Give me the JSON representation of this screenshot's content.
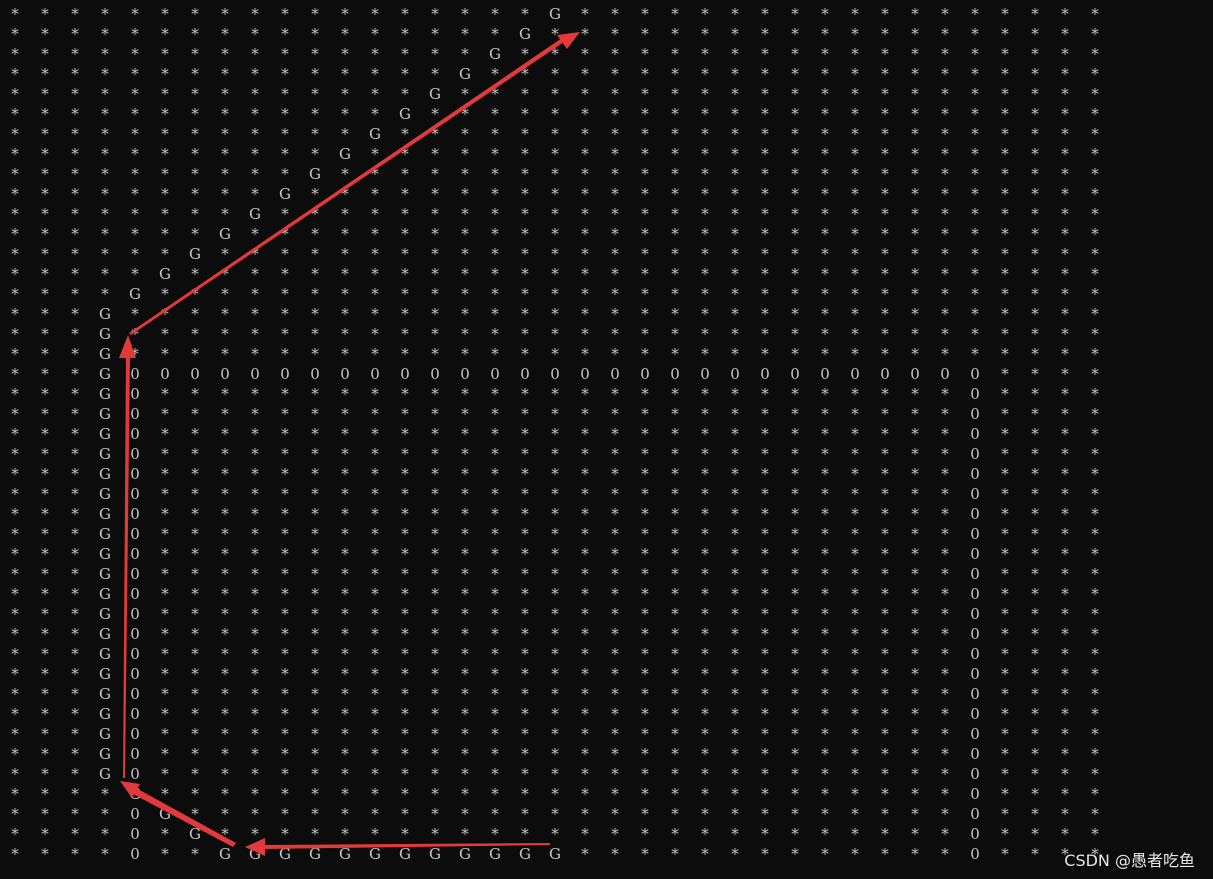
{
  "console": {
    "rows": 43,
    "cols": 37,
    "empty_char": "*",
    "path_char": "G",
    "wall_char": "0",
    "path_cells": [
      [
        0,
        18
      ],
      [
        1,
        17
      ],
      [
        2,
        16
      ],
      [
        3,
        15
      ],
      [
        4,
        14
      ],
      [
        5,
        13
      ],
      [
        6,
        12
      ],
      [
        7,
        11
      ],
      [
        8,
        10
      ],
      [
        9,
        9
      ],
      [
        10,
        8
      ],
      [
        11,
        7
      ],
      [
        12,
        6
      ],
      [
        13,
        5
      ],
      [
        14,
        4
      ],
      [
        15,
        3
      ],
      [
        16,
        3
      ],
      [
        17,
        3
      ],
      [
        18,
        3
      ],
      [
        19,
        3
      ],
      [
        20,
        3
      ],
      [
        21,
        3
      ],
      [
        22,
        3
      ],
      [
        23,
        3
      ],
      [
        24,
        3
      ],
      [
        25,
        3
      ],
      [
        26,
        3
      ],
      [
        27,
        3
      ],
      [
        28,
        3
      ],
      [
        29,
        3
      ],
      [
        30,
        3
      ],
      [
        31,
        3
      ],
      [
        32,
        3
      ],
      [
        33,
        3
      ],
      [
        34,
        3
      ],
      [
        35,
        3
      ],
      [
        36,
        3
      ],
      [
        37,
        3
      ],
      [
        38,
        3
      ],
      [
        39,
        4
      ],
      [
        40,
        5
      ],
      [
        41,
        6
      ],
      [
        42,
        7
      ],
      [
        42,
        8
      ],
      [
        42,
        9
      ],
      [
        42,
        10
      ],
      [
        42,
        11
      ],
      [
        42,
        12
      ],
      [
        42,
        13
      ],
      [
        42,
        14
      ],
      [
        42,
        15
      ],
      [
        42,
        16
      ],
      [
        42,
        17
      ],
      [
        42,
        18
      ]
    ],
    "wall_cells": [
      [
        18,
        4
      ],
      [
        18,
        5
      ],
      [
        18,
        6
      ],
      [
        18,
        7
      ],
      [
        18,
        8
      ],
      [
        18,
        9
      ],
      [
        18,
        10
      ],
      [
        18,
        11
      ],
      [
        18,
        12
      ],
      [
        18,
        13
      ],
      [
        18,
        14
      ],
      [
        18,
        15
      ],
      [
        18,
        16
      ],
      [
        18,
        17
      ],
      [
        18,
        18
      ],
      [
        18,
        19
      ],
      [
        18,
        20
      ],
      [
        18,
        21
      ],
      [
        18,
        22
      ],
      [
        18,
        23
      ],
      [
        18,
        24
      ],
      [
        18,
        25
      ],
      [
        18,
        26
      ],
      [
        18,
        27
      ],
      [
        18,
        28
      ],
      [
        18,
        29
      ],
      [
        18,
        30
      ],
      [
        18,
        31
      ],
      [
        18,
        32
      ],
      [
        19,
        4
      ],
      [
        20,
        4
      ],
      [
        21,
        4
      ],
      [
        22,
        4
      ],
      [
        23,
        4
      ],
      [
        24,
        4
      ],
      [
        25,
        4
      ],
      [
        26,
        4
      ],
      [
        27,
        4
      ],
      [
        28,
        4
      ],
      [
        29,
        4
      ],
      [
        30,
        4
      ],
      [
        31,
        4
      ],
      [
        32,
        4
      ],
      [
        33,
        4
      ],
      [
        34,
        4
      ],
      [
        35,
        4
      ],
      [
        36,
        4
      ],
      [
        37,
        4
      ],
      [
        38,
        4
      ],
      [
        19,
        32
      ],
      [
        20,
        32
      ],
      [
        21,
        32
      ],
      [
        22,
        32
      ],
      [
        23,
        32
      ],
      [
        24,
        32
      ],
      [
        25,
        32
      ],
      [
        26,
        32
      ],
      [
        27,
        32
      ],
      [
        28,
        32
      ],
      [
        29,
        32
      ],
      [
        30,
        32
      ],
      [
        31,
        32
      ],
      [
        32,
        32
      ],
      [
        33,
        32
      ],
      [
        34,
        32
      ],
      [
        35,
        32
      ],
      [
        36,
        32
      ],
      [
        37,
        32
      ],
      [
        38,
        32
      ],
      [
        39,
        32
      ],
      [
        40,
        32
      ],
      [
        41,
        32
      ],
      [
        42,
        32
      ],
      [
        40,
        4
      ],
      [
        41,
        4
      ],
      [
        42,
        4
      ]
    ]
  },
  "annotations": {
    "arrow_color": "#e23a3a",
    "arrows": [
      "right-to-left along bottom",
      "diagonal up-left",
      "vertical up",
      "diagonal up-right"
    ]
  },
  "watermark": {
    "text": "CSDN @愚者吃鱼"
  }
}
